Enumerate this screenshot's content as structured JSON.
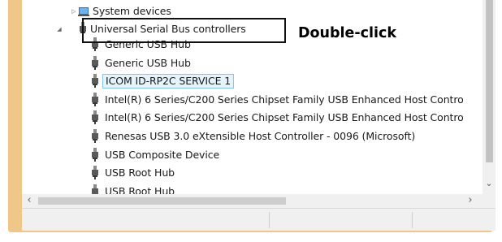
{
  "tree": {
    "system_devices": "System devices",
    "usb_controllers": "Universal Serial Bus controllers",
    "items": [
      "Generic USB Hub",
      "Generic USB Hub",
      "ICOM ID-RP2C SERVICE 1",
      "Intel(R) 6 Series/C200 Series Chipset Family USB Enhanced Host Contro",
      "Intel(R) 6 Series/C200 Series Chipset Family USB Enhanced Host Contro",
      "Renesas USB 3.0 eXtensible Host Controller - 0096 (Microsoft)",
      "USB Composite Device",
      "USB Root Hub",
      "USB Root Hub"
    ],
    "selected_index": 2
  },
  "callout": {
    "text": "Double-click"
  },
  "icons": {
    "collapsed": "triangle-right-icon",
    "expanded": "triangle-down-icon",
    "system": "system-devices-icon",
    "usb": "usb-plug-icon"
  },
  "colors": {
    "frame": "#f0c689",
    "selection_bg": "#e5f3fb",
    "selection_border": "#84c6ef"
  }
}
